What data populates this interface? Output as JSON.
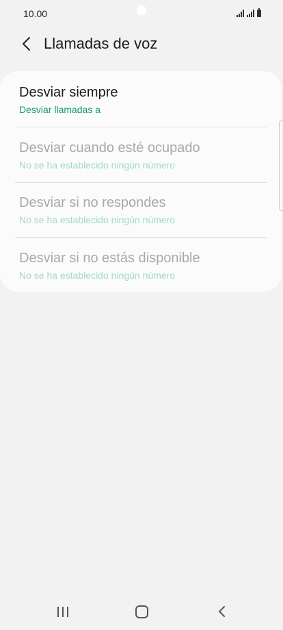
{
  "status_bar": {
    "time": "10.00"
  },
  "header": {
    "title": "Llamadas de voz",
    "back_icon": "chevron-left-icon"
  },
  "forwarding_options": [
    {
      "title": "Desviar siempre",
      "subtitle": "Desviar llamadas a",
      "enabled": true
    },
    {
      "title": "Desviar cuando esté ocupado",
      "subtitle": "No se ha establecido ningún número",
      "enabled": false
    },
    {
      "title": "Desviar si no respondes",
      "subtitle": "No se ha establecido ningún número",
      "enabled": false
    },
    {
      "title": "Desviar si no estás disponible",
      "subtitle": "No se ha establecido ningún número",
      "enabled": false
    }
  ],
  "colors": {
    "background": "#f2f2f2",
    "card": "#fbfbfb",
    "accent_green": "#149a66",
    "disabled_text": "#a9a9a9"
  },
  "navigation_bar": {
    "recent_icon": "recent-apps-icon",
    "home_icon": "home-icon",
    "back_icon": "back-icon"
  }
}
